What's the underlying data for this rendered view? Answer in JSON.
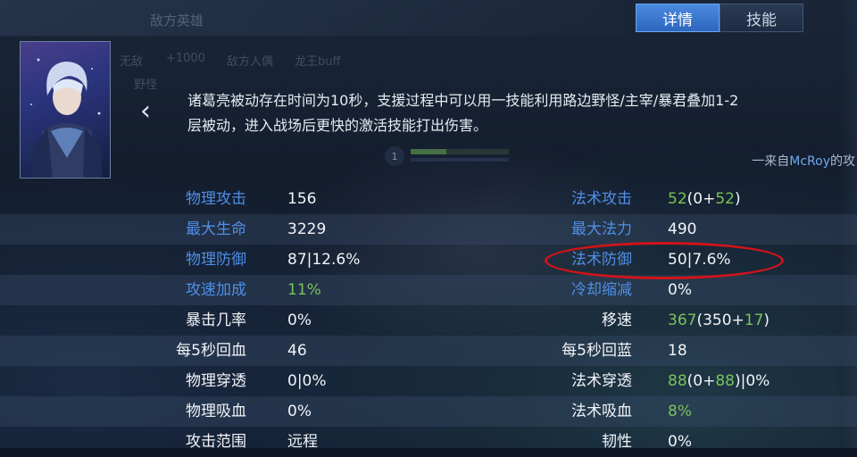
{
  "tabs": [
    {
      "label": "详情",
      "active": true
    },
    {
      "label": "技能",
      "active": false
    }
  ],
  "background_hint": {
    "header_title": "敌方英雄",
    "labels": [
      "无敌",
      "+1000",
      "敌方人偶",
      "龙王buff",
      "野怪"
    ]
  },
  "passive": {
    "line1": "诸葛亮被动存在时间为10秒，支援过程中可以用一技能利用路边野怪/主宰/暴君叠加1-2",
    "line2": "层被动，进入战场后更快的激活技能打出伤害。",
    "author_prefix": "一来自",
    "author_name": "McRoy",
    "author_suffix": "的攻"
  },
  "stats": [
    {
      "left": {
        "label": "物理攻击",
        "label_color": "blue",
        "value": [
          {
            "t": "156",
            "c": "white"
          }
        ]
      },
      "right": {
        "label": "法术攻击",
        "label_color": "blue",
        "value": [
          {
            "t": "52",
            "c": "green"
          },
          {
            "t": "(0+",
            "c": "white"
          },
          {
            "t": "52",
            "c": "green"
          },
          {
            "t": ")",
            "c": "white"
          }
        ]
      }
    },
    {
      "left": {
        "label": "最大生命",
        "label_color": "blue",
        "value": [
          {
            "t": "3229",
            "c": "white"
          }
        ]
      },
      "right": {
        "label": "最大法力",
        "label_color": "blue",
        "value": [
          {
            "t": "490",
            "c": "white"
          }
        ]
      }
    },
    {
      "left": {
        "label": "物理防御",
        "label_color": "blue",
        "value": [
          {
            "t": "87|12.6%",
            "c": "white"
          }
        ]
      },
      "right": {
        "label": "法术防御",
        "label_color": "blue",
        "value": [
          {
            "t": "50|7.6%",
            "c": "white"
          }
        ]
      }
    },
    {
      "left": {
        "label": "攻速加成",
        "label_color": "blue",
        "value": [
          {
            "t": "11%",
            "c": "green"
          }
        ]
      },
      "right": {
        "label": "冷却缩减",
        "label_color": "blue",
        "value": [
          {
            "t": "0%",
            "c": "white"
          }
        ]
      }
    },
    {
      "left": {
        "label": "暴击几率",
        "label_color": "white",
        "value": [
          {
            "t": "0%",
            "c": "white"
          }
        ]
      },
      "right": {
        "label": "移速",
        "label_color": "white",
        "value": [
          {
            "t": "367",
            "c": "green"
          },
          {
            "t": "(350+",
            "c": "white"
          },
          {
            "t": "17",
            "c": "green"
          },
          {
            "t": ")",
            "c": "white"
          }
        ]
      }
    },
    {
      "left": {
        "label": "每5秒回血",
        "label_color": "white",
        "value": [
          {
            "t": "46",
            "c": "white"
          }
        ]
      },
      "right": {
        "label": "每5秒回蓝",
        "label_color": "white",
        "value": [
          {
            "t": "18",
            "c": "white"
          }
        ]
      }
    },
    {
      "left": {
        "label": "物理穿透",
        "label_color": "white",
        "value": [
          {
            "t": "0|0%",
            "c": "white"
          }
        ]
      },
      "right": {
        "label": "法术穿透",
        "label_color": "white",
        "value": [
          {
            "t": "88",
            "c": "green"
          },
          {
            "t": "(0+",
            "c": "white"
          },
          {
            "t": "88",
            "c": "green"
          },
          {
            "t": ")|0%",
            "c": "white"
          }
        ]
      }
    },
    {
      "left": {
        "label": "物理吸血",
        "label_color": "white",
        "value": [
          {
            "t": "0%",
            "c": "white"
          }
        ]
      },
      "right": {
        "label": "法术吸血",
        "label_color": "white",
        "value": [
          {
            "t": "8%",
            "c": "green"
          }
        ]
      }
    },
    {
      "left": {
        "label": "攻击范围",
        "label_color": "white",
        "value": [
          {
            "t": "远程",
            "c": "white"
          }
        ]
      },
      "right": {
        "label": "韧性",
        "label_color": "white",
        "value": [
          {
            "t": "0%",
            "c": "white"
          }
        ]
      }
    }
  ],
  "mini_level": "1",
  "colors": {
    "blue_label": "#4f8fe6",
    "green_value": "#79c25a",
    "annotation": "#d0141a"
  }
}
